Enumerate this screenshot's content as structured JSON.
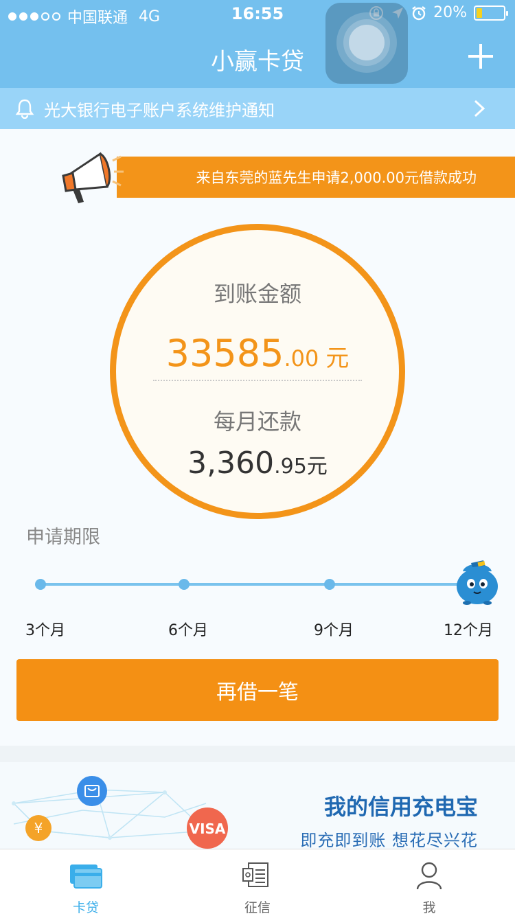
{
  "status_bar": {
    "carrier": "中国联通",
    "network": "4G",
    "time": "16:55",
    "battery": "20%"
  },
  "nav": {
    "title": "小赢卡贷"
  },
  "notice": {
    "text": "光大银行电子账户系统维护通知"
  },
  "broadcast": {
    "text": "来自东莞的蓝先生申请2,000.00元借款成功"
  },
  "loan": {
    "arrival_label": "到账金额",
    "arrival_integer": "33585",
    "arrival_decimal": ".00",
    "arrival_unit": "元",
    "monthly_label": "每月还款",
    "monthly_integer": "3,360",
    "monthly_decimal": ".95",
    "monthly_unit": "元"
  },
  "term": {
    "label": "申请期限",
    "options": [
      "3个月",
      "6个月",
      "9个月",
      "12个月"
    ],
    "selected": "12个月"
  },
  "actions": {
    "borrow_again": "再借一笔"
  },
  "promo": {
    "title": "我的信用充电宝",
    "subtitle": "即充即到账  想花尽兴花"
  },
  "tabs": [
    {
      "label": "卡贷",
      "icon": "card-icon",
      "active": true
    },
    {
      "label": "征信",
      "icon": "credit-report-icon",
      "active": false
    },
    {
      "label": "我",
      "icon": "person-icon",
      "active": false
    }
  ],
  "colors": {
    "header": "#74c0ee",
    "accent_orange": "#f39419",
    "tab_active": "#3aaeea"
  }
}
